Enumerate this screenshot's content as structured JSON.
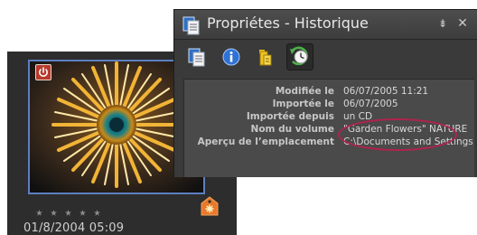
{
  "thumbnail": {
    "date": "01/8/2004 05:09",
    "rating_stars": 5
  },
  "panel": {
    "title": "Propriétes - Historique",
    "controls": {
      "collapse": "⇟",
      "close": "✕"
    },
    "toolbar": [
      {
        "icon": "general-properties-icon"
      },
      {
        "icon": "info-icon"
      },
      {
        "icon": "tags-icon"
      },
      {
        "icon": "history-icon",
        "active": true
      }
    ],
    "properties": [
      {
        "label": "Modifiée le",
        "value": "06/07/2005 11:21"
      },
      {
        "label": "Importée le",
        "value": "06/07/2005"
      },
      {
        "label": "Importée depuis",
        "value": "un CD"
      },
      {
        "label": "Nom du volume",
        "value": "\"Garden Flowers\" NATURE"
      },
      {
        "label": "Aperçu de l’emplacement",
        "value": "C:\\Documents and Settings"
      }
    ]
  },
  "colors": {
    "panel_bg": "#3a3a3a",
    "props_bg": "#4a4a4a",
    "thumb_bg": "#2d2d2d",
    "selection_border": "#5d7fc2",
    "highlight_ellipse": "#b2224e"
  }
}
